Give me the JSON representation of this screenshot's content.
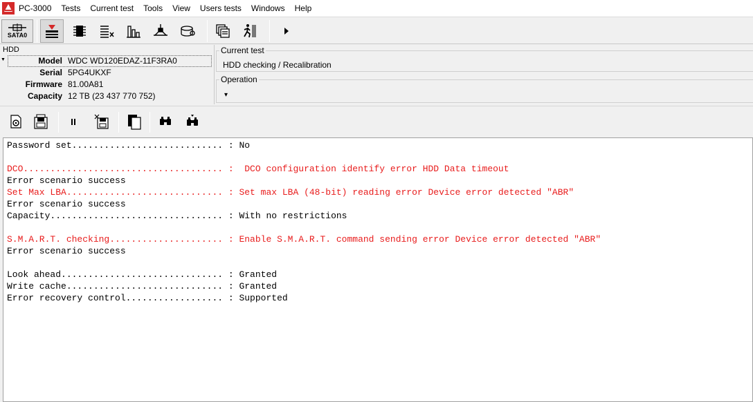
{
  "app": {
    "title": "PC-3000"
  },
  "menu": [
    "Tests",
    "Current test",
    "Tools",
    "View",
    "Users tests",
    "Windows",
    "Help"
  ],
  "toolbar": {
    "sata_label": "SATA0",
    "buttons": [
      "test-tool-icon",
      "chip-icon",
      "checklist-icon",
      "bar-chart-icon",
      "plug-tree-icon",
      "disk-icon",
      "windows-stack-icon",
      "runner-icon",
      "play-icon"
    ]
  },
  "hdd": {
    "title": "HDD",
    "rows": [
      {
        "label": "Model",
        "value": "WDC WD120EDAZ-11F3RA0"
      },
      {
        "label": "Serial",
        "value": "5PG4UKXF"
      },
      {
        "label": "Firmware",
        "value": "81.00A81"
      },
      {
        "label": "Capacity",
        "value": "12 TB (23 437 770 752)"
      }
    ]
  },
  "current_test": {
    "title": "Current test",
    "value": "HDD checking / Recalibration"
  },
  "operation": {
    "title": "Operation",
    "dropdown": "▾"
  },
  "colors": {
    "error": "#e81c1c",
    "logo": "#d42a2a"
  },
  "log": [
    {
      "text": "Password set............................ : No",
      "error": false
    },
    {
      "text": "",
      "error": false
    },
    {
      "text": "DCO..................................... :  DCO configuration identify error HDD Data timeout",
      "error": true
    },
    {
      "text": "Error scenario success",
      "error": false
    },
    {
      "text": "Set Max LBA............................. : Set max LBA (48-bit) reading error Device error detected \"ABR\"",
      "error": true
    },
    {
      "text": "Error scenario success",
      "error": false
    },
    {
      "text": "Capacity................................ : With no restrictions",
      "error": false
    },
    {
      "text": "",
      "error": false
    },
    {
      "text": "S.M.A.R.T. checking..................... : Enable S.M.A.R.T. command sending error Device error detected \"ABR\"",
      "error": true
    },
    {
      "text": "Error scenario success",
      "error": false
    },
    {
      "text": "",
      "error": false
    },
    {
      "text": "Look ahead.............................. : Granted",
      "error": false
    },
    {
      "text": "Write cache............................. : Granted",
      "error": false
    },
    {
      "text": "Error recovery control.................. : Supported",
      "error": false
    }
  ]
}
